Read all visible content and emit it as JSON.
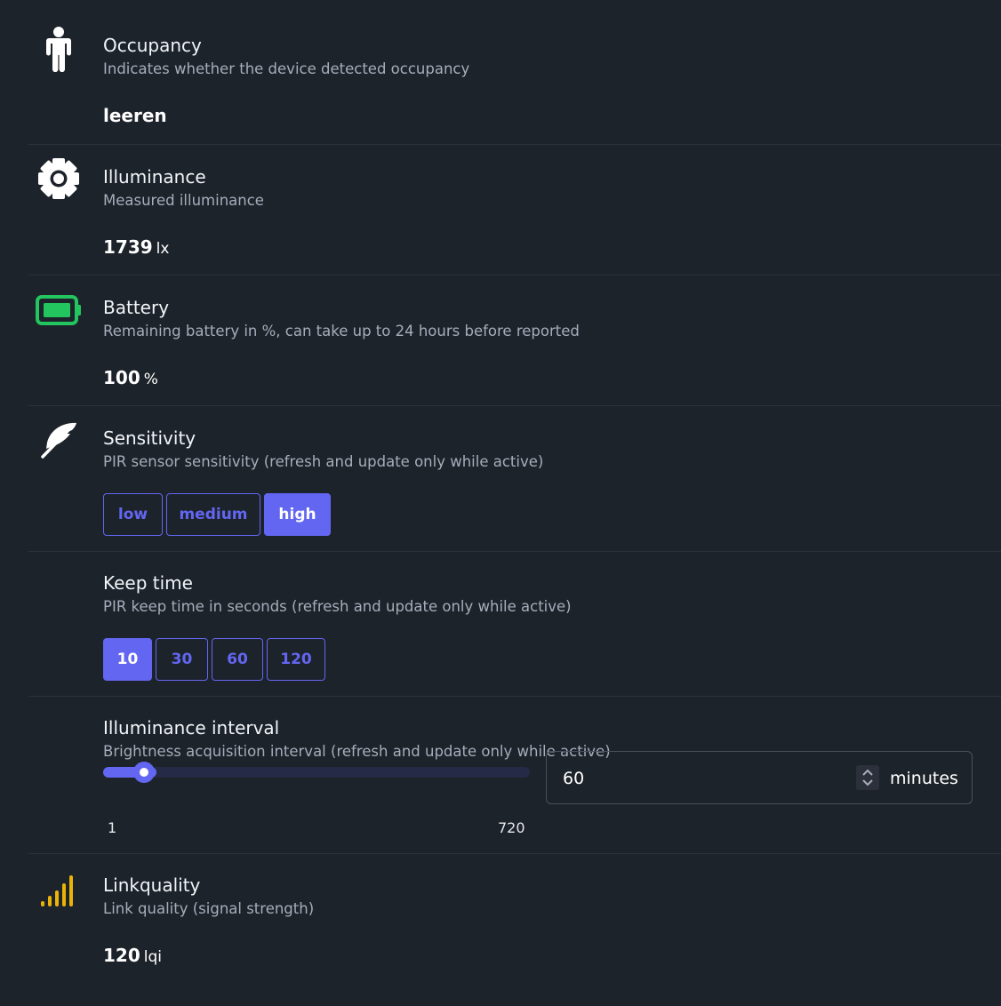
{
  "colors": {
    "background": "#1d232a",
    "accent": "#6366f1",
    "battery": "#22c55e",
    "signal": "#eab308"
  },
  "occupancy": {
    "icon": "person-icon",
    "title": "Occupancy",
    "description": "Indicates whether the device detected occupancy",
    "value": "leeren"
  },
  "illuminance": {
    "icon": "sun-gear-icon",
    "title": "Illuminance",
    "description": "Measured illuminance",
    "value": "1739",
    "unit": "lx"
  },
  "battery": {
    "icon": "battery-full-icon",
    "title": "Battery",
    "description": "Remaining battery in %, can take up to 24 hours before reported",
    "value": "100",
    "unit": "%"
  },
  "sensitivity": {
    "icon": "feather-icon",
    "title": "Sensitivity",
    "description": "PIR sensor sensitivity (refresh and update only while active)",
    "options": [
      "low",
      "medium",
      "high"
    ],
    "selected": "high"
  },
  "keep_time": {
    "title": "Keep time",
    "description": "PIR keep time in seconds (refresh and update only while active)",
    "options": [
      "10",
      "30",
      "60",
      "120"
    ],
    "selected": "10"
  },
  "illuminance_interval": {
    "title": "Illuminance interval",
    "description": "Brightness acquisition interval (refresh and update only while active)",
    "slider_min": "1",
    "slider_max": "720",
    "value": "60",
    "unit": "minutes"
  },
  "linkquality": {
    "icon": "signal-bars-icon",
    "title": "Linkquality",
    "description": "Link quality (signal strength)",
    "value": "120",
    "unit": "lqi"
  }
}
